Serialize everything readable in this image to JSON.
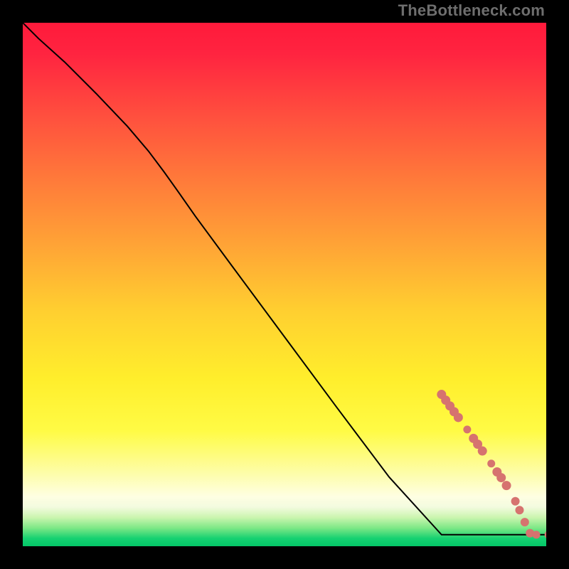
{
  "watermark_text": "TheBottleneck.com",
  "colors": {
    "frame": "#000000",
    "line": "#000000",
    "dot_fill": "#d6736f",
    "dot_stroke": "#d6736f",
    "gradient_stops": [
      {
        "offset": 0,
        "color": "#ff1a3b"
      },
      {
        "offset": 0.06,
        "color": "#ff2440"
      },
      {
        "offset": 0.18,
        "color": "#ff503e"
      },
      {
        "offset": 0.3,
        "color": "#ff7a3a"
      },
      {
        "offset": 0.42,
        "color": "#ffa236"
      },
      {
        "offset": 0.55,
        "color": "#ffcf30"
      },
      {
        "offset": 0.68,
        "color": "#ffee2c"
      },
      {
        "offset": 0.78,
        "color": "#fffb45"
      },
      {
        "offset": 0.86,
        "color": "#fdfda8"
      },
      {
        "offset": 0.905,
        "color": "#fefee2"
      },
      {
        "offset": 0.925,
        "color": "#f3fbdf"
      },
      {
        "offset": 0.945,
        "color": "#cbf5af"
      },
      {
        "offset": 0.965,
        "color": "#7ee886"
      },
      {
        "offset": 0.985,
        "color": "#16d171"
      },
      {
        "offset": 1.0,
        "color": "#04c768"
      }
    ]
  },
  "chart_data": {
    "type": "line",
    "title": "",
    "xlabel": "",
    "ylabel": "",
    "xlim": [
      0,
      100
    ],
    "ylim": [
      0,
      100
    ],
    "grid": false,
    "series": [
      {
        "name": "curve",
        "kind": "line",
        "x": [
          0,
          3,
          8,
          14,
          20,
          24,
          27,
          29.5,
          33,
          40,
          50,
          60,
          70,
          80,
          84,
          86.3,
          88,
          90,
          91.8,
          93.4,
          95,
          96.4,
          98,
          100
        ],
        "y": [
          100,
          97,
          92.5,
          86.5,
          80.2,
          75.5,
          71.5,
          68,
          63,
          53.5,
          40,
          26.5,
          13.2,
          2.2,
          2.2,
          2.2,
          2.2,
          2.2,
          2.2,
          2.2,
          2.2,
          2.2,
          2.2,
          2.2
        ]
      },
      {
        "name": "dots",
        "kind": "scatter",
        "points": [
          {
            "x": 80.0,
            "y": 29.0,
            "r": 6
          },
          {
            "x": 80.8,
            "y": 27.9,
            "r": 6
          },
          {
            "x": 81.6,
            "y": 26.8,
            "r": 6
          },
          {
            "x": 82.4,
            "y": 25.7,
            "r": 6
          },
          {
            "x": 83.2,
            "y": 24.6,
            "r": 6
          },
          {
            "x": 84.9,
            "y": 22.3,
            "r": 5
          },
          {
            "x": 86.1,
            "y": 20.6,
            "r": 6
          },
          {
            "x": 86.9,
            "y": 19.5,
            "r": 6
          },
          {
            "x": 87.8,
            "y": 18.2,
            "r": 6
          },
          {
            "x": 89.5,
            "y": 15.8,
            "r": 5
          },
          {
            "x": 90.6,
            "y": 14.2,
            "r": 6
          },
          {
            "x": 91.4,
            "y": 13.1,
            "r": 6
          },
          {
            "x": 92.4,
            "y": 11.6,
            "r": 6
          },
          {
            "x": 94.1,
            "y": 8.6,
            "r": 5.5
          },
          {
            "x": 94.9,
            "y": 6.9,
            "r": 5.5
          },
          {
            "x": 95.9,
            "y": 4.6,
            "r": 5.5
          },
          {
            "x": 96.9,
            "y": 2.5,
            "r": 5.5
          },
          {
            "x": 98.1,
            "y": 2.2,
            "r": 5
          },
          {
            "x": 100.5,
            "y": 2.2,
            "r": 5.5
          },
          {
            "x": 103.0,
            "y": 2.2,
            "r": 5.5
          }
        ]
      }
    ]
  }
}
